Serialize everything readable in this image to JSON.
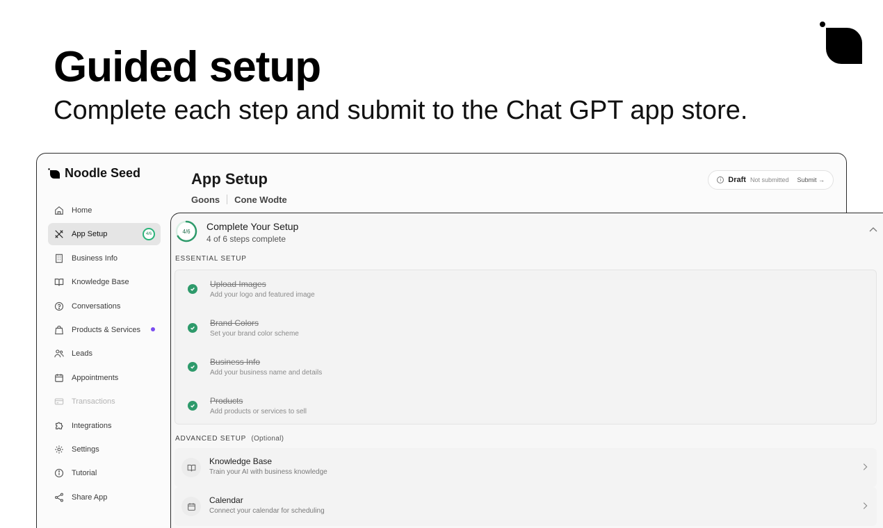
{
  "hero": {
    "title": "Guided setup",
    "subtitle": "Complete each step and submit to the Chat GPT app store."
  },
  "app": {
    "brand": "Noodle Seed",
    "title": "App Setup",
    "tabs": {
      "first": "Goons",
      "second": "Cone Wodte"
    },
    "status": {
      "label": "Draft",
      "state": "Not submitted",
      "action": "Submit →"
    }
  },
  "sidebar": {
    "items": [
      {
        "label": "Home",
        "icon": "home-icon"
      },
      {
        "label": "App Setup",
        "icon": "tools-icon",
        "badge": "4/6",
        "active": true
      },
      {
        "label": "Business Info",
        "icon": "building-icon"
      },
      {
        "label": "Knowledge Base",
        "icon": "book-icon"
      },
      {
        "label": "Conversations",
        "icon": "chat-icon"
      },
      {
        "label": "Products & Services",
        "icon": "bag-icon",
        "dot_color": "#7a4cf0"
      },
      {
        "label": "Leads",
        "icon": "users-icon"
      },
      {
        "label": "Appointments",
        "icon": "calendar-icon"
      },
      {
        "label": "Transactions",
        "icon": "card-icon",
        "muted": true
      },
      {
        "label": "Integrations",
        "icon": "puzzle-icon"
      },
      {
        "label": "Settings",
        "icon": "gear-icon"
      },
      {
        "label": "Tutorial",
        "icon": "info-icon"
      },
      {
        "label": "Share App",
        "icon": "share-icon"
      }
    ]
  },
  "setup": {
    "progress": "4/6",
    "progress_fraction": 0.667,
    "title": "Complete Your Setup",
    "subtitle": "4 of 6 steps complete",
    "essential_label": "ESSENTIAL SETUP",
    "essential": [
      {
        "title": "Upload Images",
        "desc": "Add your logo and featured image"
      },
      {
        "title": "Brand Colors",
        "desc": "Set your brand color scheme"
      },
      {
        "title": "Business Info",
        "desc": "Add your business name and details"
      },
      {
        "title": "Products",
        "desc": "Add products or services to sell"
      }
    ],
    "advanced_label": "ADVANCED SETUP",
    "advanced_optional": "(Optional)",
    "advanced": [
      {
        "title": "Knowledge Base",
        "desc": "Train your AI with business knowledge",
        "icon": "book-icon"
      },
      {
        "title": "Calendar",
        "desc": "Connect your calendar for scheduling",
        "icon": "calendar-icon"
      }
    ]
  },
  "colors": {
    "accent_green": "#2e9a6b",
    "dot_purple": "#7a4cf0"
  }
}
